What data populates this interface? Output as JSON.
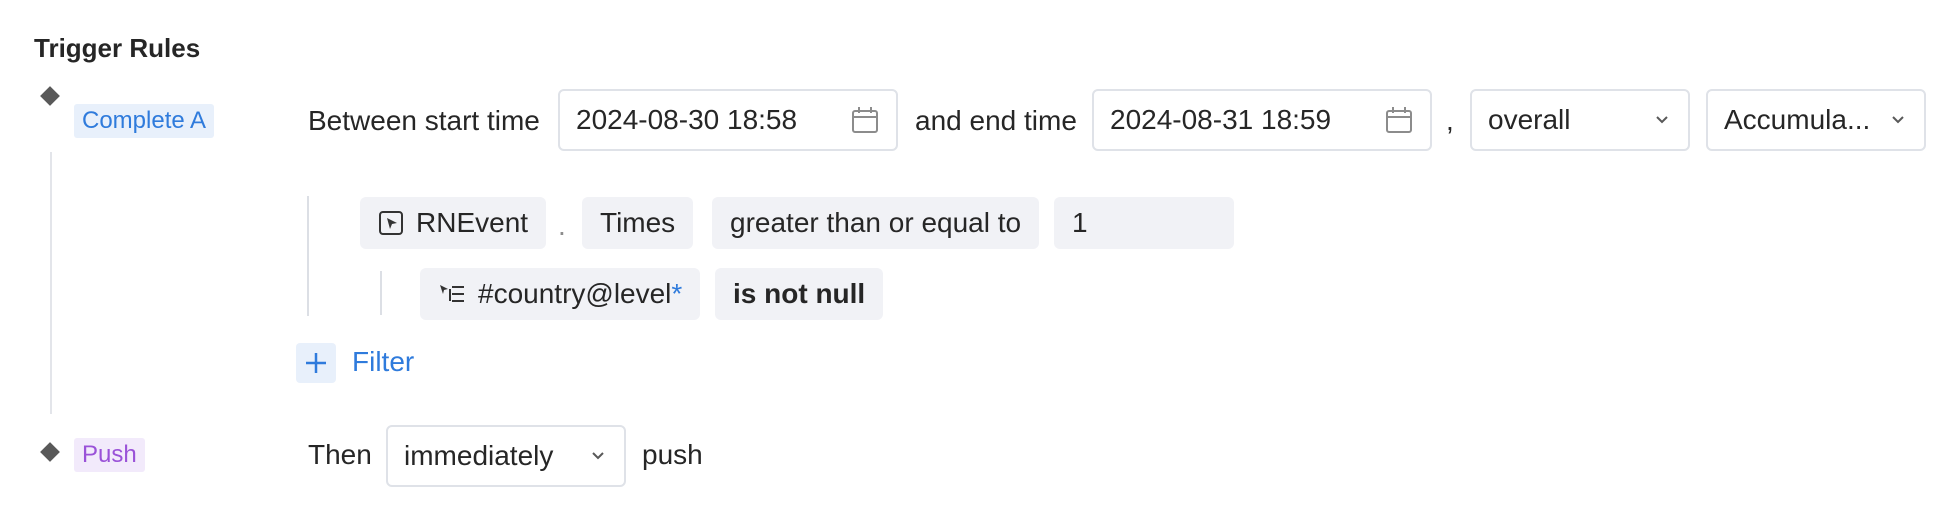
{
  "section": {
    "title": "Trigger Rules"
  },
  "stepA": {
    "tag": "Complete A",
    "between_label": "Between start time",
    "start_time": "2024-08-30 18:58",
    "and_end_label": "and end time",
    "end_time": "2024-08-31 18:59",
    "comma": ",",
    "scope_select": "overall",
    "mode_select": "Accumula...",
    "event": {
      "name": "RNEvent",
      "dot": ".",
      "metric": "Times",
      "operator": "greater than or equal to",
      "value": "1"
    },
    "filter_condition": {
      "property": "#country@level",
      "asterisk": "*",
      "operator": "is not null"
    },
    "add_filter_label": "Filter"
  },
  "stepPush": {
    "tag": "Push",
    "then_label": "Then",
    "timing_select": "immediately",
    "push_label": "push"
  },
  "colors": {
    "accent_blue": "#2f7bdc",
    "tag_purple": "#9a52d8",
    "chip_bg": "#f1f2f6",
    "border": "#dfe2e8"
  }
}
